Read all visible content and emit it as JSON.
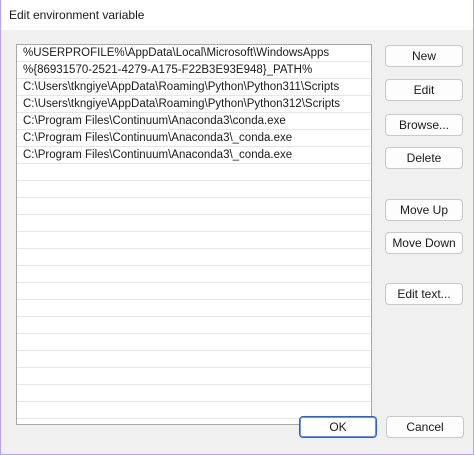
{
  "window": {
    "title": "Edit environment variable"
  },
  "list": {
    "items": [
      "%USERPROFILE%\\AppData\\Local\\Microsoft\\WindowsApps",
      "%{86931570-2521-4279-A175-F22B3E93E948}_PATH%",
      "C:\\Users\\tkngiye\\AppData\\Roaming\\Python\\Python311\\Scripts",
      "C:\\Users\\tkngiye\\AppData\\Roaming\\Python\\Python312\\Scripts",
      "C:\\Program Files\\Continuum\\Anaconda3\\conda.exe",
      "C:\\Program Files\\Continuum\\Anaconda3\\_conda.exe",
      "C:\\Program Files\\Continuum\\Anaconda3\\_conda.exe"
    ],
    "empty_rows": 15
  },
  "buttons": {
    "new": "New",
    "edit": "Edit",
    "browse": "Browse...",
    "delete": "Delete",
    "move_up": "Move Up",
    "move_down": "Move Down",
    "edit_text": "Edit text..."
  },
  "footer": {
    "ok": "OK",
    "cancel": "Cancel"
  },
  "colors": {
    "accent_border": "#b9a3f0",
    "default_button_border": "#2a64c8"
  }
}
